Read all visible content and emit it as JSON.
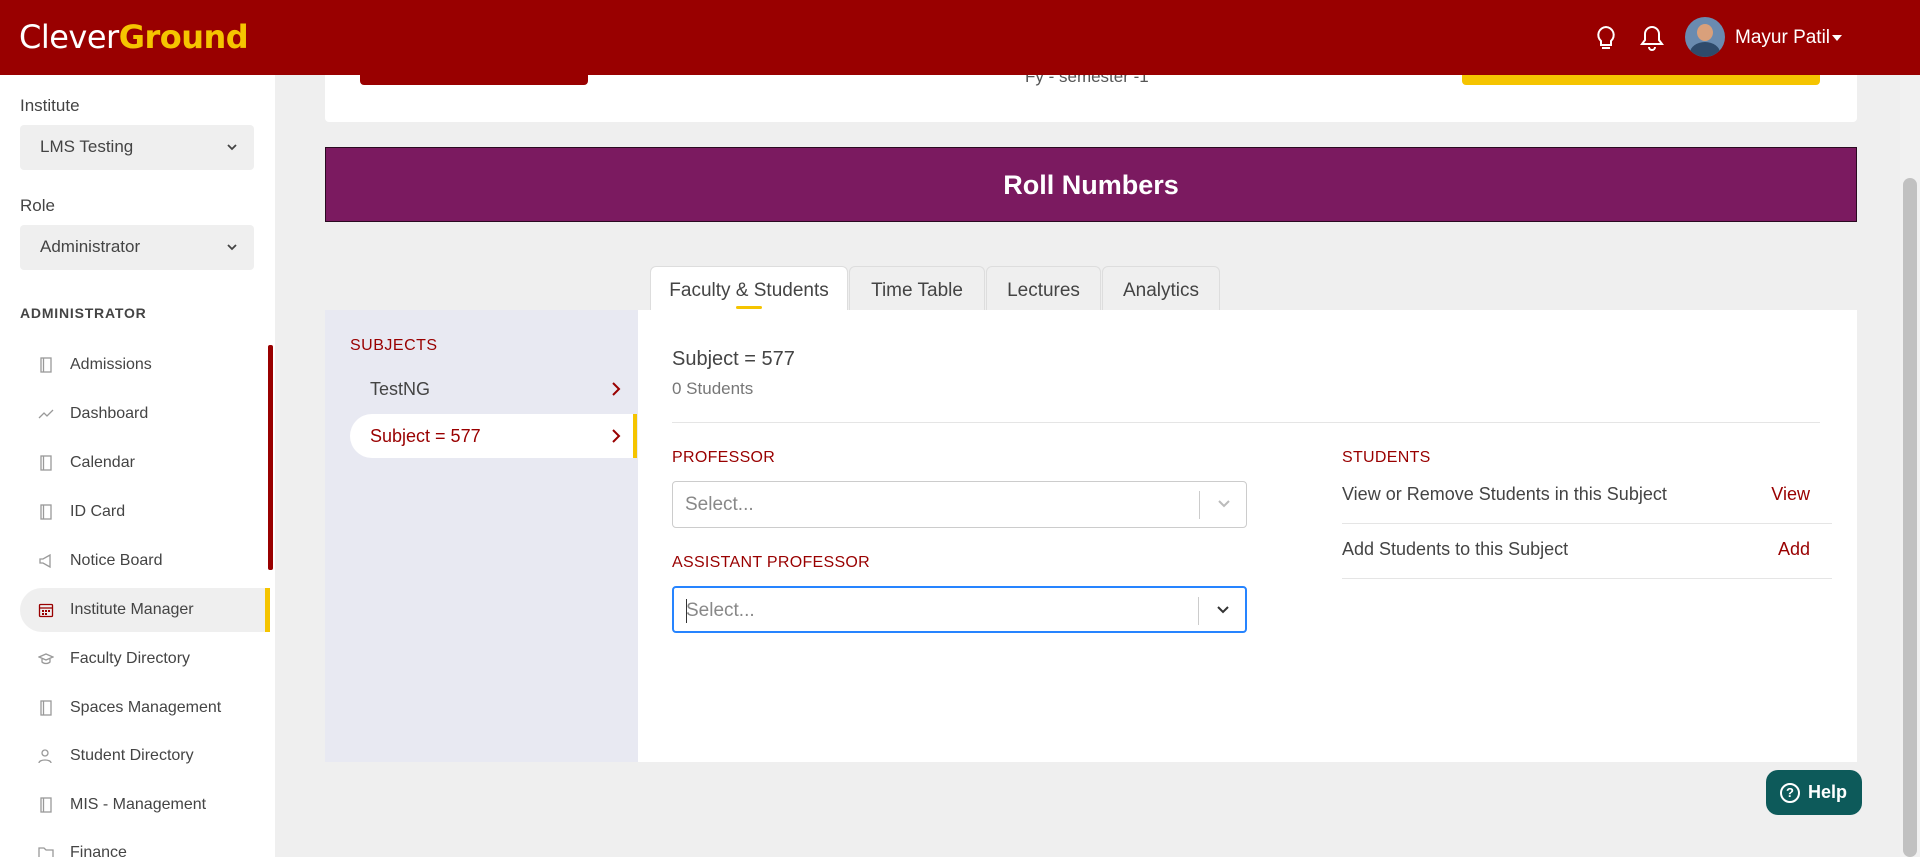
{
  "brand": {
    "part1": "Clever",
    "part2": "Ground"
  },
  "header": {
    "user_name": "Mayur Patil",
    "icons": [
      "lightbulb-icon",
      "bell-icon"
    ]
  },
  "sidebar": {
    "institute_label": "Institute",
    "institute_value": "LMS Testing",
    "role_label": "Role",
    "role_value": "Administrator",
    "section_heading": "ADMINISTRATOR",
    "items": [
      {
        "label": "Admissions",
        "icon": "book-icon"
      },
      {
        "label": "Dashboard",
        "icon": "trend-icon"
      },
      {
        "label": "Calendar",
        "icon": "book-icon"
      },
      {
        "label": "ID Card",
        "icon": "book-icon"
      },
      {
        "label": "Notice Board",
        "icon": "megaphone-icon"
      },
      {
        "label": "Institute Manager",
        "icon": "calendar-grid-icon"
      },
      {
        "label": "Faculty Directory",
        "icon": "graduation-cap-icon"
      },
      {
        "label": "Spaces Management",
        "icon": "book-icon"
      },
      {
        "label": "Student Directory",
        "icon": "user-icon"
      },
      {
        "label": "MIS - Management",
        "icon": "book-icon"
      },
      {
        "label": "Finance",
        "icon": "folder-icon"
      }
    ]
  },
  "top_card": {
    "semester_text": "Fy - semester -1"
  },
  "banner": {
    "title": "Roll Numbers"
  },
  "tabs": [
    {
      "label": "Faculty & Students"
    },
    {
      "label": "Time Table"
    },
    {
      "label": "Lectures"
    },
    {
      "label": "Analytics"
    }
  ],
  "subjects": {
    "heading": "SUBJECTS",
    "items": [
      {
        "label": "TestNG"
      },
      {
        "label": "Subject = 577"
      }
    ]
  },
  "detail": {
    "title": "Subject = 577",
    "student_count": "0 Students",
    "professor_label": "PROFESSOR",
    "professor_placeholder": "Select...",
    "assistant_label": "ASSISTANT PROFESSOR",
    "assistant_placeholder": "Select...",
    "students_heading": "STUDENTS",
    "rows": [
      {
        "text": "View or Remove Students in this Subject",
        "link": "View"
      },
      {
        "text": "Add Students to this Subject",
        "link": "Add"
      }
    ]
  },
  "help": {
    "label": "Help"
  },
  "colors": {
    "primary": "#990000",
    "accent": "#f5c400",
    "banner": "#7b1a60",
    "help": "#0d5a5a"
  }
}
